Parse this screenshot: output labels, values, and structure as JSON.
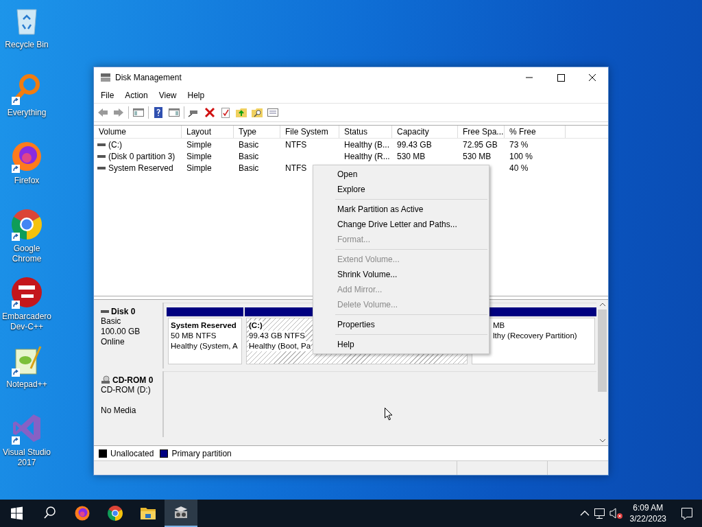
{
  "desktop_icons": [
    {
      "label": "Recycle Bin",
      "kind": "recycle",
      "shortcut": false
    },
    {
      "label": "Everything",
      "kind": "everything",
      "shortcut": true
    },
    {
      "label": "Firefox",
      "kind": "firefox",
      "shortcut": true
    },
    {
      "label": "Google Chrome",
      "kind": "chrome",
      "shortcut": true
    },
    {
      "label": "Embarcadero Dev-C++",
      "kind": "devcpp",
      "shortcut": true
    },
    {
      "label": "Notepad++",
      "kind": "notepad",
      "shortcut": true
    },
    {
      "label": "Visual Studio 2017",
      "kind": "vs",
      "shortcut": true
    }
  ],
  "window": {
    "title": "Disk Management",
    "menu": [
      "File",
      "Action",
      "View",
      "Help"
    ],
    "columns": [
      "Volume",
      "Layout",
      "Type",
      "File System",
      "Status",
      "Capacity",
      "Free Spa...",
      "% Free"
    ],
    "rows": [
      {
        "volume": " (C:)",
        "layout": "Simple",
        "type": "Basic",
        "file_system": "NTFS",
        "status": "Healthy (B...",
        "capacity": "99.43 GB",
        "free_space": "72.95 GB",
        "percent_free": "73 %"
      },
      {
        "volume": "(Disk 0 partition 3)",
        "layout": "Simple",
        "type": "Basic",
        "status": "Healthy (R...",
        "capacity": "530 MB",
        "free_space": "530 MB",
        "percent_free": "100 %"
      },
      {
        "volume": "System Reserved",
        "layout": "Simple",
        "type": "Basic",
        "file_system": "NTFS",
        "percent_free": "40 %"
      }
    ],
    "disks": [
      {
        "name": "Disk 0",
        "kind": "disk",
        "type": "Basic",
        "size": "100.00 GB",
        "status": "Online",
        "partitions": [
          {
            "title": "System Reserved",
            "lines": [
              "50 MB NTFS",
              "Healthy (System, A"
            ],
            "selected": false
          },
          {
            "title": "(C:)",
            "lines": [
              "99.43 GB NTFS",
              "Healthy (Boot, Pa"
            ],
            "selected": true
          },
          {
            "lines": [
              "MB",
              "lthy (Recovery Partition)"
            ],
            "selected": false
          }
        ]
      },
      {
        "name": "CD-ROM 0",
        "kind": "cdrom",
        "type": "CD-ROM (D:)",
        "status": "No Media"
      }
    ],
    "legend": [
      {
        "label": "Unallocated",
        "color": "#000000"
      },
      {
        "label": "Primary partition",
        "color": "#000080"
      }
    ]
  },
  "context_menu": [
    {
      "kind": "item",
      "label": "Open",
      "disabled": false
    },
    {
      "kind": "item",
      "label": "Explore",
      "disabled": false
    },
    {
      "kind": "separator"
    },
    {
      "kind": "item",
      "label": "Mark Partition as Active",
      "disabled": false
    },
    {
      "kind": "item",
      "label": "Change Drive Letter and Paths...",
      "disabled": false
    },
    {
      "kind": "item",
      "label": "Format...",
      "disabled": true
    },
    {
      "kind": "separator"
    },
    {
      "kind": "item",
      "label": "Extend Volume...",
      "disabled": true
    },
    {
      "kind": "item",
      "label": "Shrink Volume...",
      "disabled": false
    },
    {
      "kind": "item",
      "label": "Add Mirror...",
      "disabled": true
    },
    {
      "kind": "item",
      "label": "Delete Volume...",
      "disabled": true
    },
    {
      "kind": "separator"
    },
    {
      "kind": "item",
      "label": "Properties",
      "disabled": false
    },
    {
      "kind": "separator"
    },
    {
      "kind": "item",
      "label": "Help",
      "disabled": false
    }
  ],
  "taskbar": {
    "apps": [
      {
        "kind": "firefox",
        "selected": false
      },
      {
        "kind": "chrome",
        "selected": false
      },
      {
        "kind": "explorer",
        "selected": false
      },
      {
        "kind": "diskmgmt",
        "selected": true
      }
    ],
    "time": "6:09 AM",
    "date": "3/22/2023"
  }
}
